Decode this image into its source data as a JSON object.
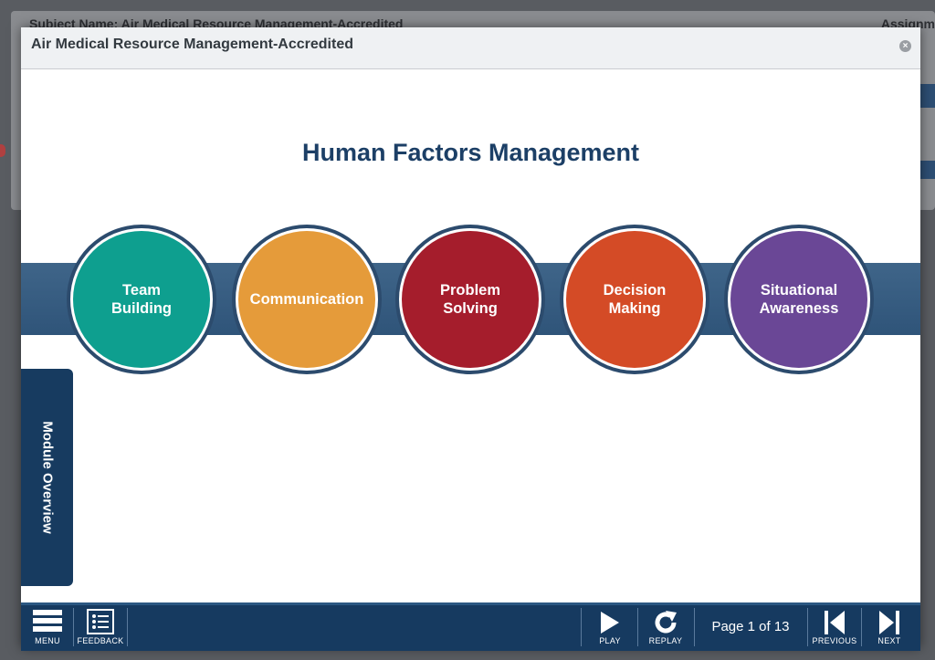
{
  "background": {
    "header_text": "Subject Name: Air Medical Resource Management-Accredited",
    "right_text": "Assignm"
  },
  "modal": {
    "title": "Air Medical Resource Management-Accredited",
    "close_symbol": "×"
  },
  "slide": {
    "title": "Human Factors Management",
    "circles": [
      {
        "label": "Team\nBuilding",
        "color": "#0e9f8f"
      },
      {
        "label": "Communication",
        "color": "#e59b3a"
      },
      {
        "label": "Problem\nSolving",
        "color": "#a51d2c"
      },
      {
        "label": "Decision\nMaking",
        "color": "#d44b26"
      },
      {
        "label": "Situational\nAwareness",
        "color": "#6a4796"
      }
    ],
    "side_tab_label": "Module Overview"
  },
  "footer": {
    "menu_label": "MENU",
    "feedback_label": "FEEDBACK",
    "play_label": "PLAY",
    "replay_label": "REPLAY",
    "page_indicator": "Page 1 of 13",
    "previous_label": "PREVIOUS",
    "next_label": "NEXT"
  },
  "icons": [
    "menu-icon",
    "feedback-icon",
    "play-icon",
    "replay-icon",
    "previous-icon",
    "next-icon",
    "close-icon"
  ]
}
